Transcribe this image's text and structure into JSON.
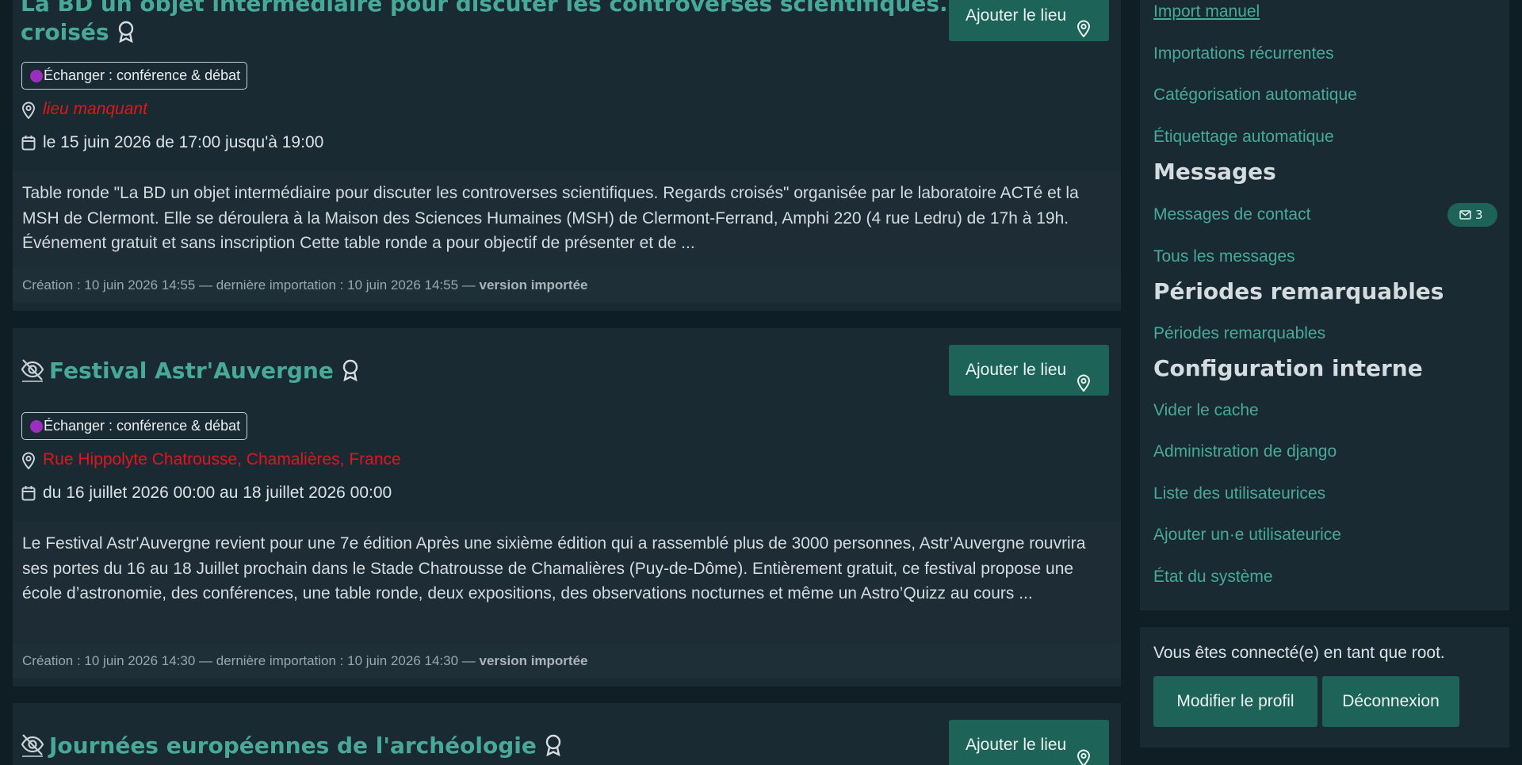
{
  "events": [
    {
      "title_line1": "La BD un objet intermédiaire pour discuter les controverses scientifiques. Regards",
      "title_line2": "croisés",
      "add_place_label": "Ajouter le lieu",
      "tag": "Échanger : conférence & débat",
      "location": "lieu manquant",
      "date": "le 15 juin 2026 de 17:00 jusqu'à 19:00",
      "description": "Table ronde \"La BD un objet intermédiaire pour discuter les controverses scientifiques. Regards croisés\" organisée par le laboratoire ACTé et la MSH de Clermont. Elle se déroulera à la Maison des Sciences Humaines (MSH) de Clermont-Ferrand, Amphi 220 (4 rue Ledru) de 17h à 19h. Événement gratuit et sans inscription Cette table ronde a pour objectif de présenter et de ...",
      "footer": "Création : 10 juin 2026 14:55 — dernière importation : 10 juin 2026 14:55 —",
      "footer_bold": "version importée"
    },
    {
      "title": "Festival Astr'Auvergne",
      "add_place_label": "Ajouter le lieu",
      "tag": "Échanger : conférence & débat",
      "location": "Rue Hippolyte Chatrousse, Chamalières, France",
      "date": "du 16 juillet 2026 00:00 au 18 juillet 2026 00:00",
      "description": "Le Festival Astr'Auvergne revient pour une 7e édition Après une sixième édition qui a rassemblé plus de 3000 personnes, Astr’Auvergne rouvrira ses portes du 16 au 18 Juillet prochain dans le Stade Chatrousse de Chamalières (Puy-de-Dôme). Entièrement gratuit, ce festival propose une école d’astronomie, des conférences, une table ronde, deux expositions, des observations nocturnes et même un Astro’Quizz au cours ...",
      "footer": "Création : 10 juin 2026 14:30 — dernière importation : 10 juin 2026 14:30 —",
      "footer_bold": "version importée"
    },
    {
      "title": "Journées européennes de l'archéologie",
      "add_place_label": "Ajouter le lieu"
    }
  ],
  "sidebar": {
    "import_manual": "Import manuel",
    "recurring_imports": "Importations récurrentes",
    "auto_categorization": "Catégorisation automatique",
    "auto_tagging": "Étiquettage automatique",
    "messages_heading": "Messages",
    "contact_messages": "Messages de contact",
    "contact_messages_count": "3",
    "all_messages": "Tous les messages",
    "periods_heading": "Périodes remarquables",
    "periods_link": "Périodes remarquables",
    "config_heading": "Configuration interne",
    "clear_cache": "Vider le cache",
    "django_admin": "Administration de django",
    "users_list": "Liste des utilisateurices",
    "add_user": "Ajouter un·e utilisateurice",
    "system_status": "État du système"
  },
  "user": {
    "logged_in_text": "Vous êtes connecté(e) en tant que root.",
    "edit_profile": "Modifier le profil",
    "logout": "Déconnexion"
  },
  "colors": {
    "accent": "#48a999",
    "button": "#1e6358",
    "warning_text": "#e3141d",
    "tag_dot": "#9a2fbf",
    "background": "#0f1d24",
    "panel": "#1a2a33"
  },
  "icons": [
    "award-icon",
    "hidden-eye-icon",
    "map-pin-icon",
    "calendar-icon",
    "mail-icon"
  ]
}
